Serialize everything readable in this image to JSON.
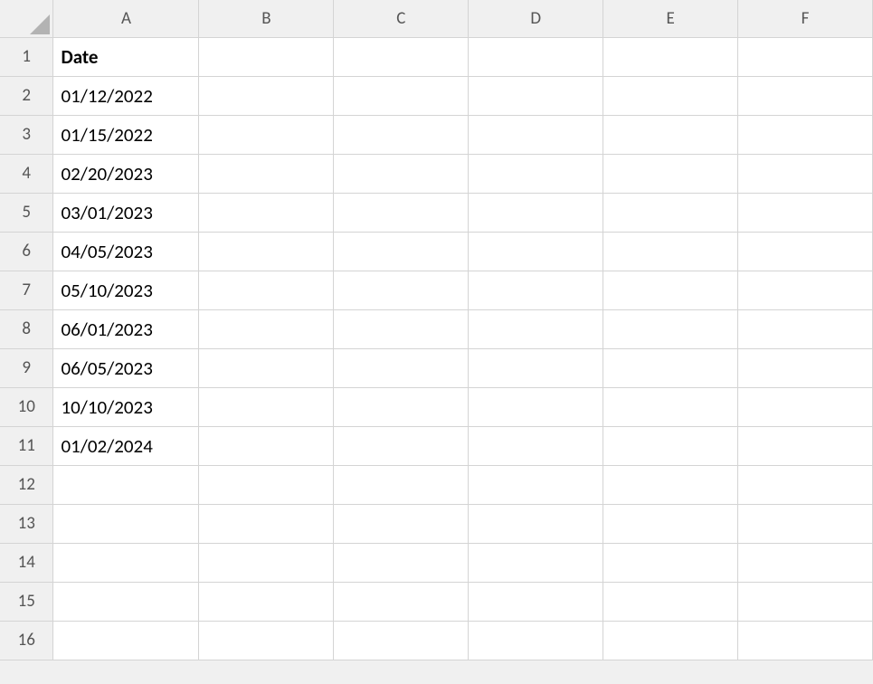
{
  "columns": [
    "A",
    "B",
    "C",
    "D",
    "E",
    "F"
  ],
  "rowCount": 16,
  "header": {
    "label": "Date"
  },
  "cells": {
    "A1": "Date",
    "A2": "01/12/2022",
    "A3": "01/15/2022",
    "A4": "02/20/2023",
    "A5": "03/01/2023",
    "A6": "04/05/2023",
    "A7": "05/10/2023",
    "A8": "06/01/2023",
    "A9": "06/05/2023",
    "A10": "10/10/2023",
    "A11": "01/02/2024"
  }
}
